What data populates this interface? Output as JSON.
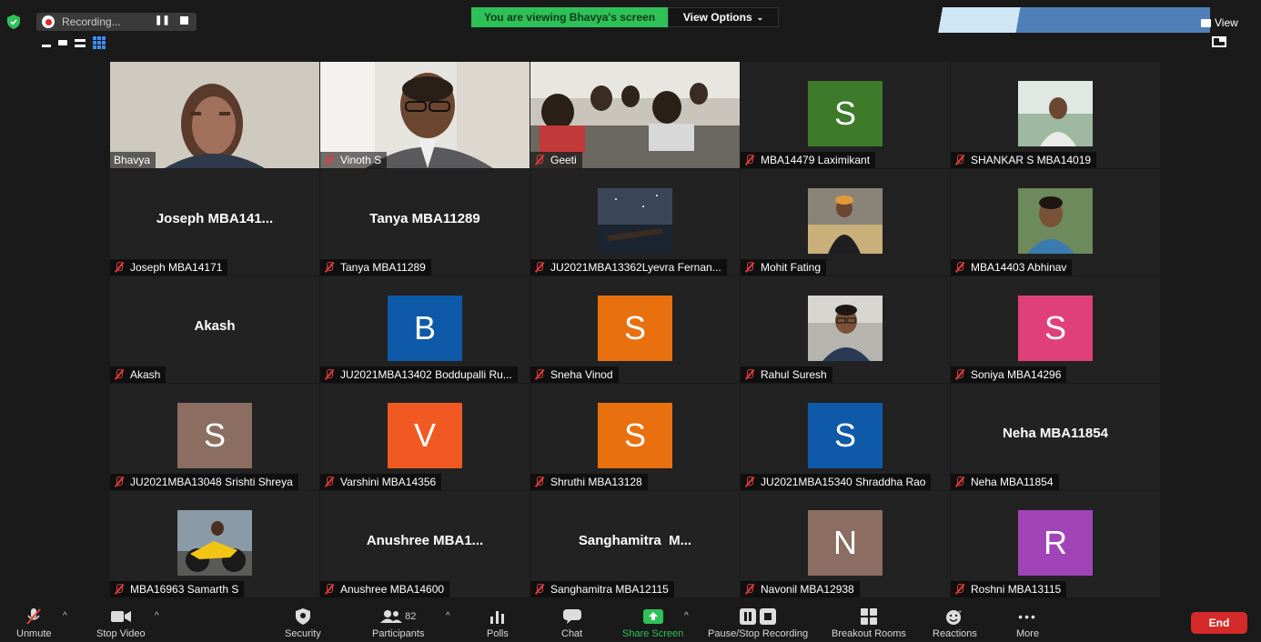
{
  "topbar": {
    "recording_label": "Recording...",
    "viewing_banner": "You are viewing Bhavya's screen",
    "view_options": "View Options",
    "view_label": "View",
    "colors": {
      "banner_green": "#2ec158",
      "record_red": "#e02828"
    }
  },
  "tiles": [
    {
      "name": "Bhavya",
      "muted": false,
      "type": "video",
      "active": true
    },
    {
      "name": "Vinoth S",
      "muted": true,
      "type": "video"
    },
    {
      "name": "Geeti",
      "muted": true,
      "type": "video"
    },
    {
      "name": "MBA14479 Laximikant",
      "muted": true,
      "type": "letter",
      "letter": "S",
      "color": "#3d7a2a"
    },
    {
      "name": "SHANKAR S MBA14019",
      "muted": true,
      "type": "photo"
    },
    {
      "name": "Joseph MBA14171",
      "muted": true,
      "type": "text",
      "display": "Joseph MBA141..."
    },
    {
      "name": "Tanya MBA11289",
      "muted": true,
      "type": "text",
      "display": "Tanya MBA11289"
    },
    {
      "name": "JU2021MBA13362Lyevra Fernan...",
      "muted": true,
      "type": "photo"
    },
    {
      "name": "Mohit Fating",
      "muted": true,
      "type": "photo"
    },
    {
      "name": "MBA14403 Abhinav",
      "muted": true,
      "type": "photo"
    },
    {
      "name": "Akash",
      "muted": true,
      "type": "text",
      "display": "Akash"
    },
    {
      "name": "JU2021MBA13402 Boddupalli Ru...",
      "muted": true,
      "type": "letter",
      "letter": "B",
      "color": "#0e5aa8"
    },
    {
      "name": "Sneha Vinod",
      "muted": true,
      "type": "letter",
      "letter": "S",
      "color": "#e8700e"
    },
    {
      "name": "Rahul Suresh",
      "muted": true,
      "type": "photo"
    },
    {
      "name": "Soniya MBA14296",
      "muted": true,
      "type": "letter",
      "letter": "S",
      "color": "#e0407a"
    },
    {
      "name": "JU2021MBA13048 Srishti Shreya",
      "muted": true,
      "type": "letter",
      "letter": "S",
      "color": "#8c6d62"
    },
    {
      "name": "Varshini MBA14356",
      "muted": true,
      "type": "letter",
      "letter": "V",
      "color": "#f05a22"
    },
    {
      "name": "Shruthi MBA13128",
      "muted": true,
      "type": "letter",
      "letter": "S",
      "color": "#e8700e"
    },
    {
      "name": "JU2021MBA15340 Shraddha Rao",
      "muted": true,
      "type": "letter",
      "letter": "S",
      "color": "#0e5aa8"
    },
    {
      "name": "Neha MBA11854",
      "muted": true,
      "type": "text",
      "display": "Neha MBA11854"
    },
    {
      "name": "MBA16963 Samarth S",
      "muted": true,
      "type": "photo"
    },
    {
      "name": "Anushree MBA14600",
      "muted": true,
      "type": "text",
      "display": "Anushree MBA1..."
    },
    {
      "name": "Sanghamitra MBA12115",
      "muted": true,
      "type": "text",
      "display": "Sanghamitra  M..."
    },
    {
      "name": "Navonil MBA12938",
      "muted": true,
      "type": "letter",
      "letter": "N",
      "color": "#8c6d62"
    },
    {
      "name": "Roshni MBA13115",
      "muted": true,
      "type": "letter",
      "letter": "R",
      "color": "#a044b8"
    }
  ],
  "toolbar": {
    "unmute": "Unmute",
    "stop_video": "Stop Video",
    "security": "Security",
    "participants": "Participants",
    "participants_count": "82",
    "polls": "Polls",
    "chat": "Chat",
    "share_screen": "Share Screen",
    "pause_recording": "Pause/Stop Recording",
    "breakout_rooms": "Breakout Rooms",
    "reactions": "Reactions",
    "more": "More",
    "end": "End",
    "colors": {
      "end": "#d42a2a",
      "share": "#2ec158"
    }
  }
}
